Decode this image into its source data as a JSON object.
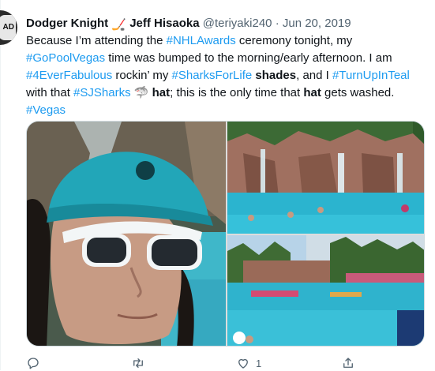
{
  "tweet": {
    "author_name": "Dodger Knight",
    "author_emoji": "🏒",
    "author_name_2": "Jeff Hisaoka",
    "handle": "@teriyaki240",
    "separator": "·",
    "date": "Jun 20, 2019",
    "avatar_text": "AD",
    "lines": {
      "l1_a": "Because I’m attending the ",
      "l1_tag": "#NHLAwards",
      "l1_b": " ceremony tonight, my",
      "l2_tag": "#GoPoolVegas",
      "l2_b": " time was bumped to the morning/early afternoon. I am",
      "l3_tag1": "#4EverFabulous",
      "l3_b": " rockin’ my ",
      "l3_tag2": "#SharksForLife",
      "l3_bold": " shades",
      "l3_c": ", and I ",
      "l3_tag3": "#TurnUpInTeal",
      "l4_a": "with that ",
      "l4_tag": "#SJSharks",
      "l4_emoji": "🦈",
      "l4_bold1": "hat",
      "l4_b": "; this is the only time that ",
      "l4_bold2": "hat",
      "l4_c": " gets washed.",
      "l5_tag": "#Vegas"
    },
    "actions": {
      "reply_count": "",
      "retweet_count": "",
      "like_count": "1",
      "share_label": ""
    }
  },
  "colors": {
    "accent": "#1d9bf0",
    "secondary_text": "#536471",
    "primary_text": "#0f1419"
  },
  "icons": [
    "reply-icon",
    "retweet-icon",
    "like-icon",
    "share-icon"
  ]
}
